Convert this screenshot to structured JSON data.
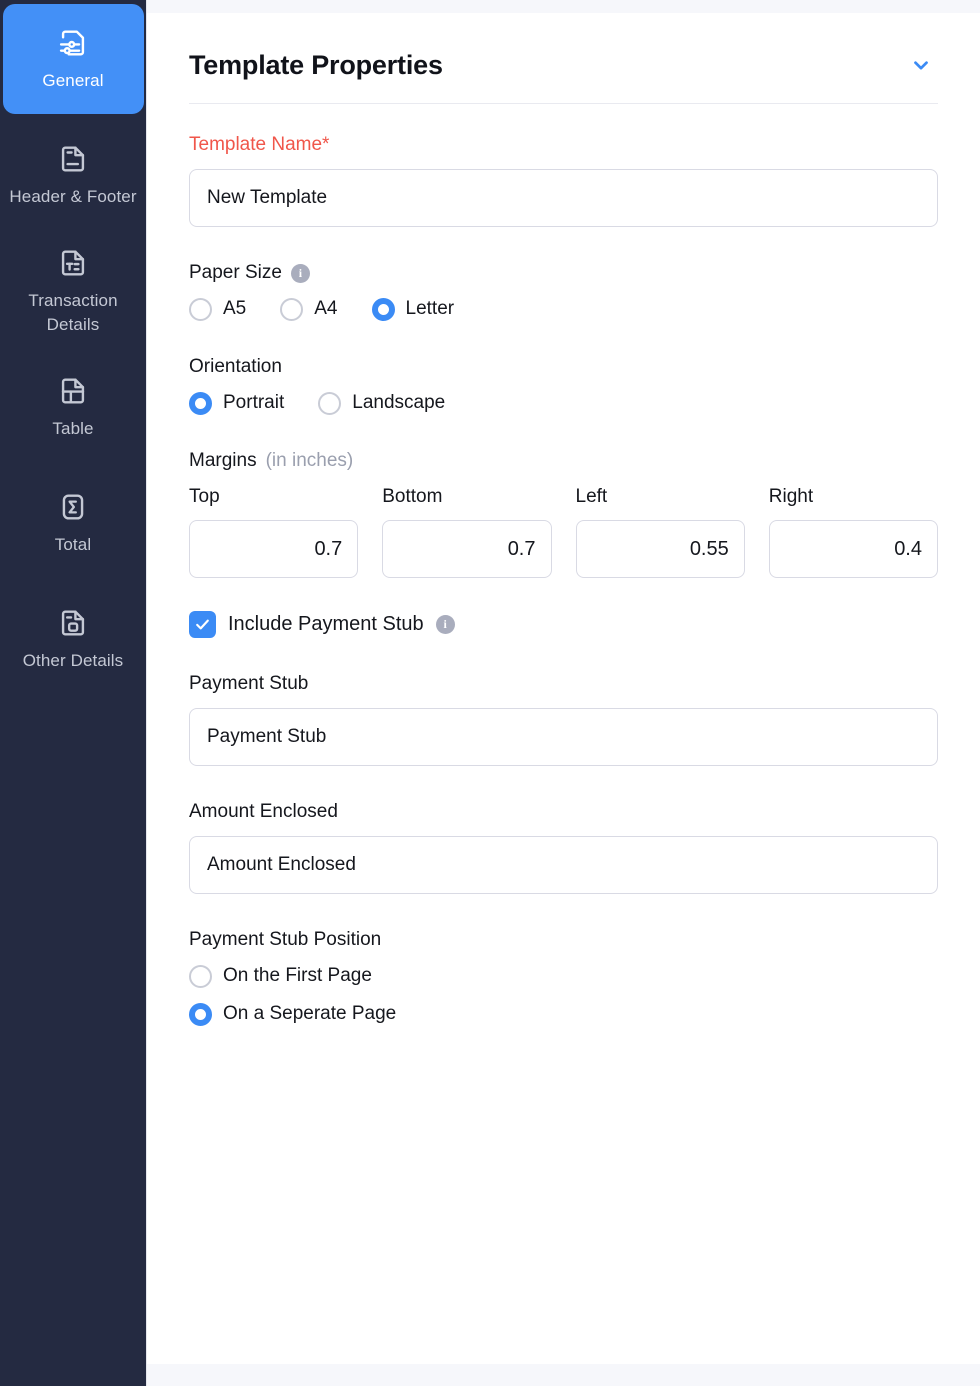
{
  "sidebar": {
    "items": [
      {
        "id": "general",
        "label": "General",
        "icon": "document-settings-icon",
        "active": true
      },
      {
        "id": "header-footer",
        "label": "Header & Footer",
        "icon": "document-lines-icon",
        "active": false
      },
      {
        "id": "transaction-details",
        "label": "Transaction Details",
        "icon": "document-text-icon",
        "active": false
      },
      {
        "id": "table",
        "label": "Table",
        "icon": "document-table-icon",
        "active": false
      },
      {
        "id": "total",
        "label": "Total",
        "icon": "document-sigma-icon",
        "active": false
      },
      {
        "id": "other-details",
        "label": "Other Details",
        "icon": "document-square-icon",
        "active": false
      }
    ]
  },
  "panel": {
    "title": "Template Properties",
    "collapse_icon": "chevron-down-icon"
  },
  "template_name": {
    "label": "Template Name*",
    "value": "New Template",
    "placeholder": "New Template"
  },
  "paper_size": {
    "label": "Paper Size",
    "info_icon": "info-icon",
    "options": [
      "A5",
      "A4",
      "Letter"
    ],
    "selected": "Letter"
  },
  "orientation": {
    "label": "Orientation",
    "options": [
      "Portrait",
      "Landscape"
    ],
    "selected": "Portrait"
  },
  "margins": {
    "label": "Margins",
    "unit_label": "(in inches)",
    "fields": [
      {
        "label": "Top",
        "value": "0.7"
      },
      {
        "label": "Bottom",
        "value": "0.7"
      },
      {
        "label": "Left",
        "value": "0.55"
      },
      {
        "label": "Right",
        "value": "0.4"
      }
    ]
  },
  "include_payment_stub": {
    "label": "Include Payment Stub",
    "checked": true,
    "info_icon": "info-icon",
    "check_icon": "check-icon"
  },
  "payment_stub": {
    "label": "Payment Stub",
    "value": "Payment Stub",
    "placeholder": "Payment Stub"
  },
  "amount_enclosed": {
    "label": "Amount Enclosed",
    "value": "Amount Enclosed",
    "placeholder": "Amount Enclosed"
  },
  "payment_stub_position": {
    "label": "Payment Stub Position",
    "options": [
      "On the First Page",
      "On a Seperate Page"
    ],
    "selected": "On a Seperate Page"
  },
  "colors": {
    "sidebar_bg": "#242a41",
    "accent": "#3b8bf5",
    "active_tile": "#4390f7",
    "required_red": "#f0564a",
    "page_bg": "#f6f7fb"
  }
}
